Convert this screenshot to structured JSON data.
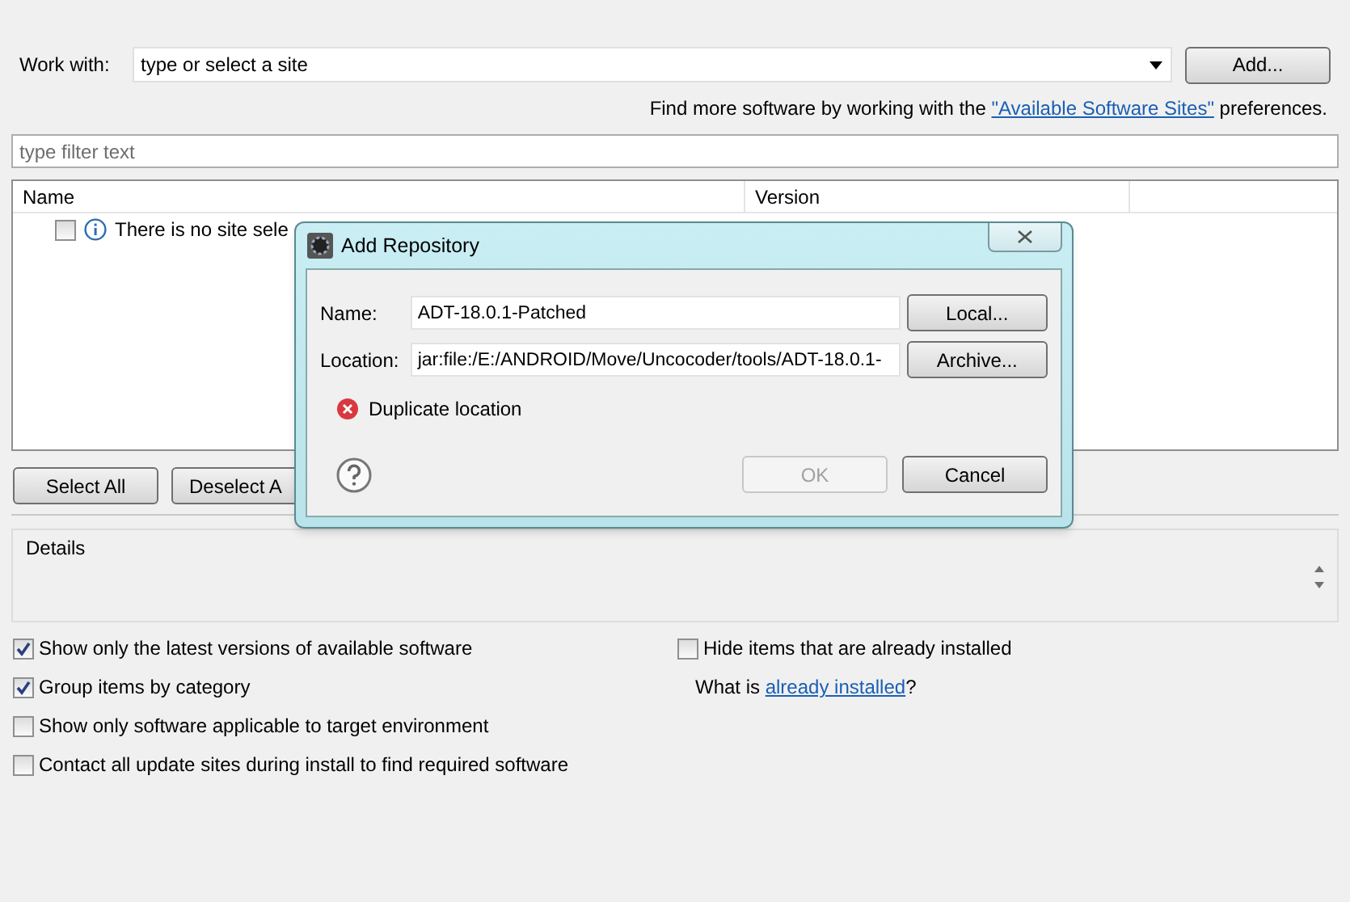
{
  "work_with": {
    "label": "Work with:",
    "placeholder": "type or select a site",
    "add_button": "Add..."
  },
  "find_more": {
    "before": "Find more software by working with the",
    "link": "\"Available Software Sites\"",
    "after": "preferences."
  },
  "filter": {
    "placeholder": "type filter text"
  },
  "table": {
    "columns": [
      "Name",
      "Version"
    ],
    "rows": [
      {
        "checked": false,
        "text": "There is no site sele"
      }
    ]
  },
  "buttons": [
    "Select All",
    "Deselect A"
  ],
  "details": {
    "title": "Details"
  },
  "options_left": [
    {
      "label": "Show only the latest versions of available software",
      "checked": true
    },
    {
      "label": "Group items by category",
      "checked": true
    },
    {
      "label": "Show only software applicable to target environment",
      "checked": false
    },
    {
      "label": "Contact all update sites during install to find required software",
      "checked": false
    }
  ],
  "options_right": {
    "checkbox": {
      "label": "Hide items that are already installed",
      "checked": false
    },
    "before": "What is",
    "link": "already installed",
    "after": "?"
  },
  "dialog": {
    "title": "Add Repository",
    "fields": [
      {
        "label": "Name:",
        "value": "ADT-18.0.1-Patched",
        "button": "Local..."
      },
      {
        "label": "Location:",
        "value": "jar:file:/E:/ANDROID/Move/Uncocoder/tools/ADT-18.0.1-",
        "button": "Archive..."
      }
    ],
    "error": "Duplicate location",
    "ok": {
      "label": "OK",
      "disabled": true
    },
    "cancel": "Cancel"
  }
}
